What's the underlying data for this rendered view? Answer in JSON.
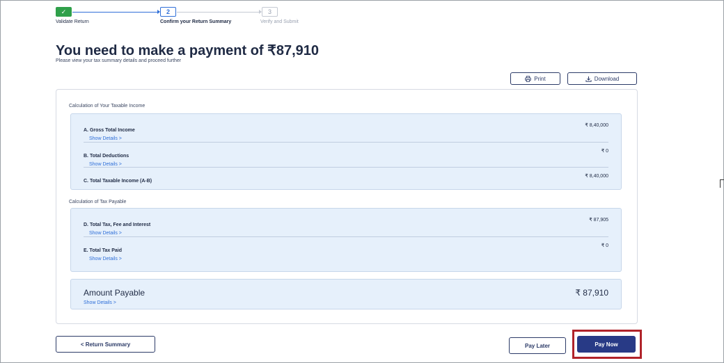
{
  "stepper": {
    "steps": [
      {
        "number": "✓",
        "label": "Validate Return"
      },
      {
        "number": "2",
        "label": "Confirm your Return Summary"
      },
      {
        "number": "3",
        "label": "Verify and Submit"
      }
    ]
  },
  "header": {
    "title": "You need to make a payment of  ₹87,910",
    "subtitle": "Please view your tax summary details and proceed further"
  },
  "toolbar": {
    "print_label": "Print",
    "download_label": "Download",
    "print_icon": "print-icon",
    "download_icon": "download-icon"
  },
  "taxable_income": {
    "title": "Calculation of Your Taxable Income",
    "rows": [
      {
        "label": "A. Gross Total Income",
        "link": "Show Details >",
        "value": "₹ 8,40,000"
      },
      {
        "label": "B. Total Deductions",
        "link": "Show Details >",
        "value": "₹ 0"
      },
      {
        "label": "C. Total Taxable Income (A-B)",
        "link": "",
        "value": "₹ 8,40,000"
      }
    ]
  },
  "tax_payable": {
    "title": "Calculation of Tax Payable",
    "rows": [
      {
        "label": "D. Total Tax, Fee and Interest",
        "link": "Show Details >",
        "value": "₹ 87,905"
      },
      {
        "label": "E. Total Tax Paid",
        "link": "Show Details >",
        "value": "₹ 0"
      }
    ]
  },
  "amount_payable": {
    "label": "Amount Payable",
    "link": "Show Details >",
    "value": "₹ 87,910"
  },
  "footer": {
    "return_label": "< Return Summary",
    "pay_later_label": "Pay Later",
    "pay_now_label": "Pay Now"
  },
  "colors": {
    "primary": "#283a86",
    "success": "#2fa04a",
    "link": "#2f6fd8",
    "panel_bg": "#e6f0fb",
    "highlight": "#b0232a"
  }
}
